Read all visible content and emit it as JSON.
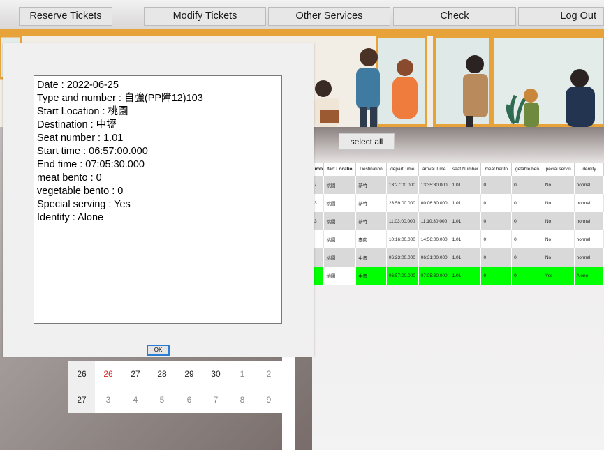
{
  "nav": {
    "reserve": "Reserve Tickets",
    "modify": "Modify Tickets",
    "other": "Other Services",
    "check": "Check",
    "logout": "Log Out"
  },
  "select_all": "select all",
  "table": {
    "headers": [
      "umb",
      "tart Locatio",
      "Destination",
      "depart Time",
      "arrival Time",
      "seat Number",
      "meat bento",
      "getable ben",
      "pecial servin",
      "identity"
    ],
    "rows": [
      {
        "cells": [
          "7",
          "桃園",
          "新竹",
          "13:27:00.000",
          "13:35:30.000",
          "1.01",
          "0",
          "0",
          "No",
          "normal"
        ],
        "style": "gray"
      },
      {
        "cells": [
          "3",
          "桃園",
          "新竹",
          "23:59:00.000",
          "00:06:30.000",
          "1.01",
          "0",
          "0",
          "No",
          "normal"
        ],
        "style": "white"
      },
      {
        "cells": [
          "3",
          "桃園",
          "新竹",
          "11:03:00.000",
          "11:10:30.000",
          "1.01",
          "0",
          "0",
          "No",
          "normal"
        ],
        "style": "gray"
      },
      {
        "cells": [
          "",
          "桃園",
          "臺南",
          "10:16:00.000",
          "14:56:00.000",
          "1.01",
          "0",
          "0",
          "No",
          "normal"
        ],
        "style": "white"
      },
      {
        "cells": [
          "",
          "桃園",
          "中壢",
          "06:23:00.000",
          "06:31:00.000",
          "1.01",
          "0",
          "0",
          "No",
          "normal"
        ],
        "style": "gray"
      },
      {
        "cells": [
          "",
          "桃園",
          "中壢",
          "06:57:00.000",
          "07:05:30.000",
          "1.01",
          "0",
          "0",
          "Yes",
          "Alone"
        ],
        "style": "green"
      }
    ]
  },
  "calendar": {
    "rows": [
      {
        "week": "26",
        "days": [
          "26",
          "27",
          "28",
          "29",
          "30",
          "1",
          "2"
        ]
      },
      {
        "week": "27",
        "days": [
          "3",
          "4",
          "5",
          "6",
          "7",
          "8",
          "9"
        ]
      }
    ]
  },
  "dialog": {
    "lines": [
      "Date : 2022-06-25",
      "Type and number : 自強(PP障12)103",
      "Start Location : 桃園",
      "Destination : 中壢",
      "Seat number : 1.01",
      "Start time : 06:57:00.000",
      "End time : 07:05:30.000",
      "meat bento : 0",
      "vegetable bento : 0",
      "Special serving : Yes",
      "Identity : Alone"
    ],
    "ok": "OK"
  },
  "colors": {
    "selected_row": "#00ff00",
    "rail": "#e8a23a",
    "today": "#d22222",
    "focus_border": "#2b7cd3"
  }
}
